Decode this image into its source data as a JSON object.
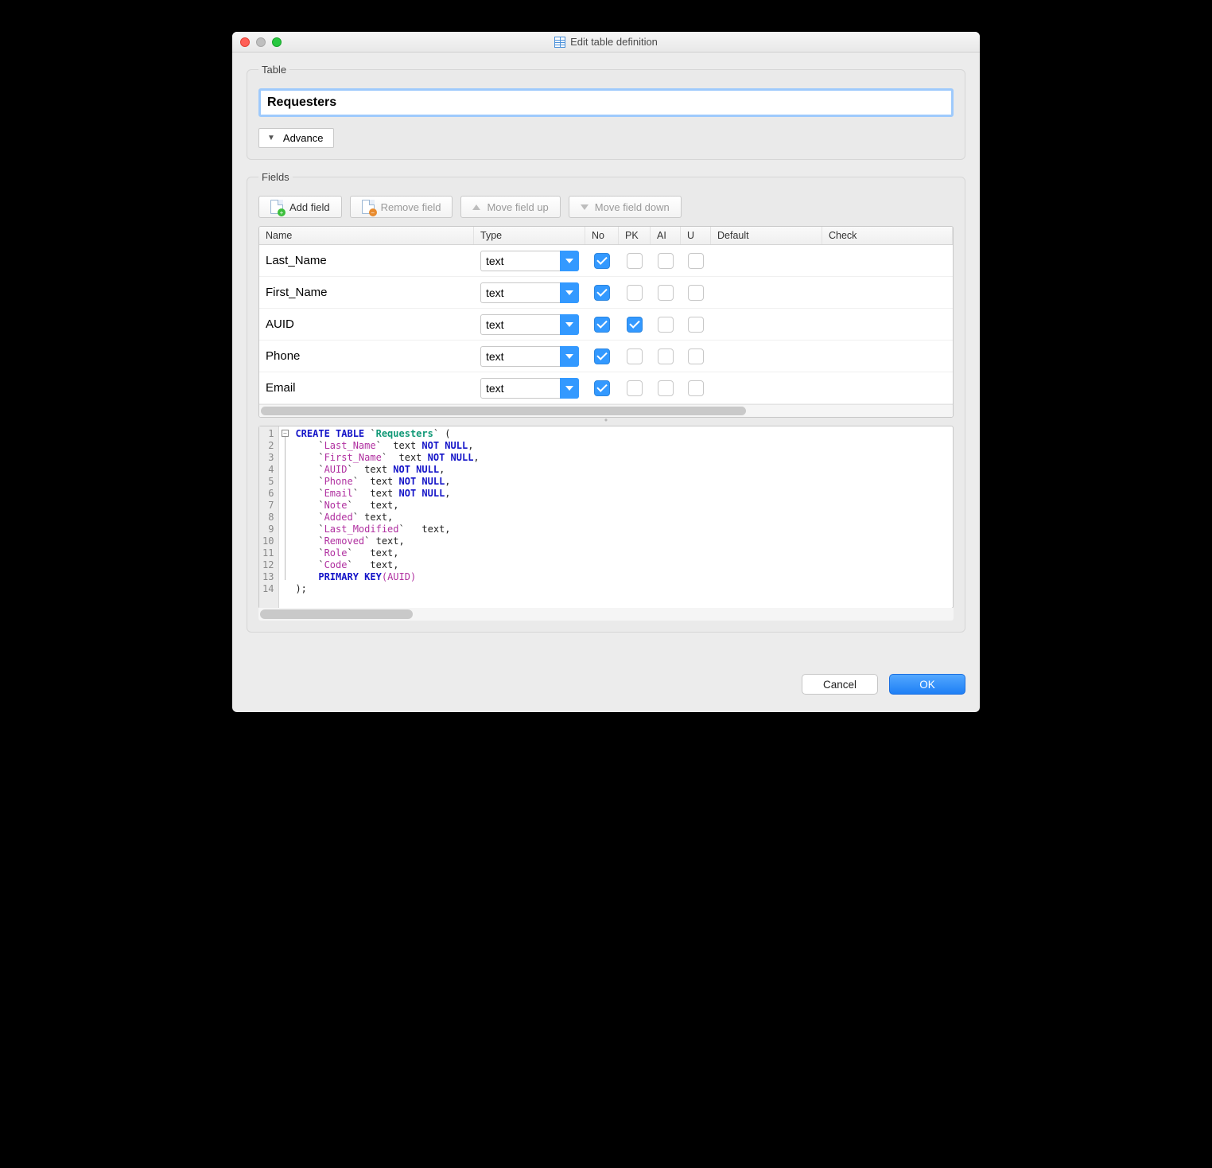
{
  "title": "Edit table definition",
  "sections": {
    "table": "Table",
    "fields": "Fields"
  },
  "table_name": "Requesters",
  "advance_label": "Advance",
  "toolbar": {
    "add": "Add field",
    "remove": "Remove field",
    "move_up": "Move field up",
    "move_down": "Move field down"
  },
  "columns": {
    "name": "Name",
    "type": "Type",
    "no": "No",
    "pk": "PK",
    "ai": "AI",
    "u": "U",
    "default": "Default",
    "check": "Check"
  },
  "rows": [
    {
      "name": "Last_Name",
      "type": "text",
      "no": true,
      "pk": false,
      "ai": false,
      "u": false
    },
    {
      "name": "First_Name",
      "type": "text",
      "no": true,
      "pk": false,
      "ai": false,
      "u": false
    },
    {
      "name": "AUID",
      "type": "text",
      "no": true,
      "pk": true,
      "ai": false,
      "u": false
    },
    {
      "name": "Phone",
      "type": "text",
      "no": true,
      "pk": false,
      "ai": false,
      "u": false
    },
    {
      "name": "Email",
      "type": "text",
      "no": true,
      "pk": false,
      "ai": false,
      "u": false
    }
  ],
  "sql_lines": [
    {
      "n": "1",
      "seg": [
        {
          "t": "CREATE TABLE",
          "c": "kw"
        },
        {
          "t": " `",
          "c": "p"
        },
        {
          "t": "Requesters",
          "c": "tn"
        },
        {
          "t": "` (",
          "c": "p"
        }
      ]
    },
    {
      "n": "2",
      "seg": [
        {
          "t": "    `",
          "c": "p"
        },
        {
          "t": "Last_Name",
          "c": "id"
        },
        {
          "t": "`  text ",
          "c": "p"
        },
        {
          "t": "NOT NULL",
          "c": "kw"
        },
        {
          "t": ",",
          "c": "p"
        }
      ]
    },
    {
      "n": "3",
      "seg": [
        {
          "t": "    `",
          "c": "p"
        },
        {
          "t": "First_Name",
          "c": "id"
        },
        {
          "t": "`  text ",
          "c": "p"
        },
        {
          "t": "NOT NULL",
          "c": "kw"
        },
        {
          "t": ",",
          "c": "p"
        }
      ]
    },
    {
      "n": "4",
      "seg": [
        {
          "t": "    `",
          "c": "p"
        },
        {
          "t": "AUID",
          "c": "id"
        },
        {
          "t": "`  text ",
          "c": "p"
        },
        {
          "t": "NOT NULL",
          "c": "kw"
        },
        {
          "t": ",",
          "c": "p"
        }
      ]
    },
    {
      "n": "5",
      "seg": [
        {
          "t": "    `",
          "c": "p"
        },
        {
          "t": "Phone",
          "c": "id"
        },
        {
          "t": "`  text ",
          "c": "p"
        },
        {
          "t": "NOT NULL",
          "c": "kw"
        },
        {
          "t": ",",
          "c": "p"
        }
      ]
    },
    {
      "n": "6",
      "seg": [
        {
          "t": "    `",
          "c": "p"
        },
        {
          "t": "Email",
          "c": "id"
        },
        {
          "t": "`  text ",
          "c": "p"
        },
        {
          "t": "NOT NULL",
          "c": "kw"
        },
        {
          "t": ",",
          "c": "p"
        }
      ]
    },
    {
      "n": "7",
      "seg": [
        {
          "t": "    `",
          "c": "p"
        },
        {
          "t": "Note",
          "c": "id"
        },
        {
          "t": "`   text,",
          "c": "p"
        }
      ]
    },
    {
      "n": "8",
      "seg": [
        {
          "t": "    `",
          "c": "p"
        },
        {
          "t": "Added",
          "c": "id"
        },
        {
          "t": "` text,",
          "c": "p"
        }
      ]
    },
    {
      "n": "9",
      "seg": [
        {
          "t": "    `",
          "c": "p"
        },
        {
          "t": "Last_Modified",
          "c": "id"
        },
        {
          "t": "`   text,",
          "c": "p"
        }
      ]
    },
    {
      "n": "10",
      "seg": [
        {
          "t": "    `",
          "c": "p"
        },
        {
          "t": "Removed",
          "c": "id"
        },
        {
          "t": "` text,",
          "c": "p"
        }
      ]
    },
    {
      "n": "11",
      "seg": [
        {
          "t": "    `",
          "c": "p"
        },
        {
          "t": "Role",
          "c": "bk"
        },
        {
          "t": "`   text,",
          "c": "p"
        }
      ]
    },
    {
      "n": "12",
      "seg": [
        {
          "t": "    `",
          "c": "p"
        },
        {
          "t": "Code",
          "c": "id"
        },
        {
          "t": "`   text,",
          "c": "p"
        }
      ]
    },
    {
      "n": "13",
      "seg": [
        {
          "t": "    ",
          "c": "p"
        },
        {
          "t": "PRIMARY KEY",
          "c": "kw"
        },
        {
          "t": "(AUID)",
          "c": "id"
        }
      ]
    },
    {
      "n": "14",
      "seg": [
        {
          "t": ");",
          "c": "p"
        }
      ]
    }
  ],
  "buttons": {
    "cancel": "Cancel",
    "ok": "OK"
  }
}
